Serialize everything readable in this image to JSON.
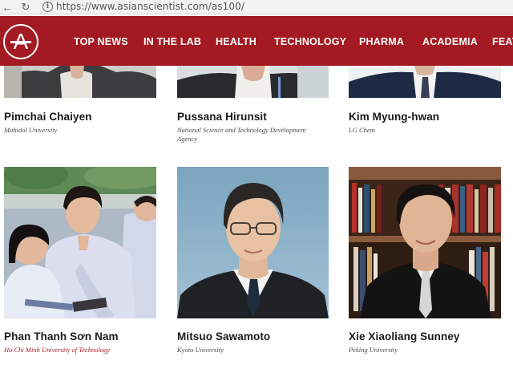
{
  "browser": {
    "url": "https://www.asianscientist.com/as100/"
  },
  "nav": {
    "logo_letter": "A",
    "items": [
      "TOP NEWS",
      "IN THE LAB",
      "HEALTH",
      "TECHNOLOGY",
      "PHARMA",
      "ACADEMIA",
      "FEAT"
    ]
  },
  "people": [
    {
      "name": "Pimchai Chaiyen",
      "affiliation": "Mahidol University"
    },
    {
      "name": "Pussana Hirunsit",
      "affiliation": "National Science and Technology Development Agency"
    },
    {
      "name": "Kim Myung-hwan",
      "affiliation": "LG Chem"
    },
    {
      "name": "Phan Thanh Sơn Nam",
      "affiliation": "Ho Chi Minh University of Technology"
    },
    {
      "name": "Mitsuo Sawamoto",
      "affiliation": "Kyoto University"
    },
    {
      "name": "Xie Xiaoliang Sunney",
      "affiliation": "Peking University"
    }
  ],
  "colors": {
    "brand_red": "#a41a22",
    "affiliation_red": "#a41a22"
  },
  "icons": [
    "back-arrow-icon",
    "reload-icon",
    "info-icon",
    "site-logo-icon"
  ]
}
